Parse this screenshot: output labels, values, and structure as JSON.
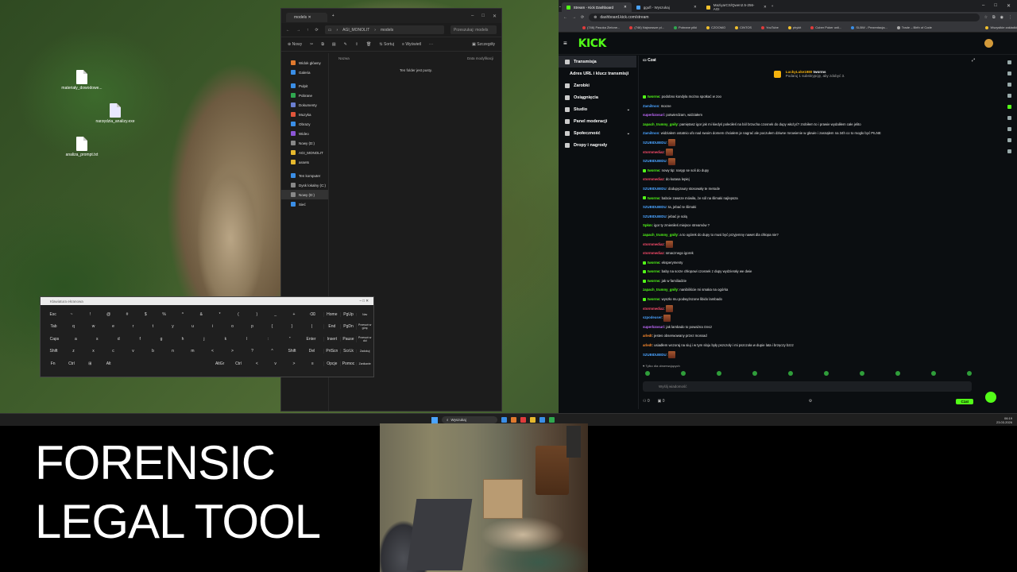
{
  "desktop": {
    "icons": [
      {
        "label": "materiały_dowodowe...",
        "type": "doc"
      },
      {
        "label": "narzędzia_analizy.exe",
        "type": "exe"
      },
      {
        "label": "analiza_prompt.txt",
        "type": "doc"
      }
    ]
  },
  "explorer": {
    "tab_title": "models",
    "path": [
      "AGI_MONOLIT",
      "models"
    ],
    "search_placeholder": "Przeszukaj: models",
    "toolbar": {
      "new": "Nowy",
      "sort": "Sortuj",
      "view": "Wyświetl",
      "details": "Szczegóły"
    },
    "sidebar": [
      {
        "label": "Widok główny",
        "color": "#e07a2e",
        "selected": false
      },
      {
        "label": "Galeria",
        "color": "#3a8ee6",
        "selected": false
      },
      {
        "label": "Pulpit",
        "color": "#3a8ee6",
        "selected": false
      },
      {
        "label": "Pobrane",
        "color": "#2fa84f",
        "selected": false
      },
      {
        "label": "Dokumenty",
        "color": "#6b7fd1",
        "selected": false
      },
      {
        "label": "Muzyka",
        "color": "#e0563b",
        "selected": false
      },
      {
        "label": "Obrazy",
        "color": "#3a8ee6",
        "selected": false
      },
      {
        "label": "Wideo",
        "color": "#8b55d6",
        "selected": false
      },
      {
        "label": "Nowy (D:)",
        "color": "#888888",
        "selected": false
      },
      {
        "label": "AGI_MONOLIT",
        "color": "#e6b82e",
        "selected": false
      },
      {
        "label": "assets",
        "color": "#e6b82e",
        "selected": false
      },
      {
        "label": "Ten komputer",
        "color": "#3a8ee6",
        "selected": false
      },
      {
        "label": "Dysk lokalny (C:)",
        "color": "#888888",
        "selected": false
      },
      {
        "label": "Nowy (D:)",
        "color": "#888888",
        "selected": true
      },
      {
        "label": "Sieć",
        "color": "#3a8ee6",
        "selected": false
      }
    ],
    "columns": {
      "name": "Nazwa",
      "date": "Data modyfikacji"
    },
    "empty_text": "Ten folder jest pusty."
  },
  "keyboard": {
    "title": "Klawiatura ekranowa",
    "rows": [
      [
        "Esc",
        "~",
        "!",
        "@",
        "#",
        "$",
        "%",
        "^",
        "&",
        "*",
        "(",
        ")",
        "_",
        "+",
        "⌫"
      ],
      [
        "Tab",
        "q",
        "w",
        "e",
        "r",
        "t",
        "y",
        "u",
        "i",
        "o",
        "p",
        "{",
        "}",
        "|"
      ],
      [
        "Caps",
        "a",
        "s",
        "d",
        "f",
        "g",
        "h",
        "j",
        "k",
        "l",
        ":",
        "\"",
        "Enter"
      ],
      [
        "Shift",
        "z",
        "x",
        "c",
        "v",
        "b",
        "n",
        "m",
        "<",
        ">",
        "?",
        "^",
        "Shift",
        "Del"
      ],
      [
        "Fn",
        "Ctrl",
        "⊞",
        "Alt",
        "",
        "AltGr",
        "Ctrl",
        "<",
        "v",
        ">",
        "≡"
      ]
    ],
    "side": [
      [
        "Home",
        "PgUp",
        "Nav"
      ],
      [
        "End",
        "PgDn",
        "Przesuń w górę"
      ],
      [
        "Insert",
        "Pause",
        "Przesuń w dół"
      ],
      [
        "PrtScn",
        "ScrLk",
        "Zadokuj"
      ],
      [
        "Opcje",
        "Pomoc",
        "Zanikanie"
      ]
    ]
  },
  "browser": {
    "tabs": [
      {
        "title": "Stream - Kick Dashboard",
        "active": true
      },
      {
        "title": "ggufl - Wyszukaj",
        "active": false
      },
      {
        "title": "MaziyarCS/Qwen2.5-256-AGI",
        "active": false
      }
    ],
    "url": "dashboard.kick.com/stream",
    "bookmarks": [
      {
        "label": "(746) Pasoka Zielone...",
        "color": "#e03b3b"
      },
      {
        "label": "(746) Najnowsze pl...",
        "color": "#e03b3b"
      },
      {
        "label": "Pobrane pliki",
        "color": "#2fa84f"
      },
      {
        "label": "CZOOMO",
        "color": "#f2c12e"
      },
      {
        "label": "CINTOS",
        "color": "#f2c12e"
      },
      {
        "label": "YouTube",
        "color": "#e03b3b"
      },
      {
        "label": "phykit",
        "color": "#f2c12e"
      },
      {
        "label": "Cuber Poker onli...",
        "color": "#e03b3b"
      },
      {
        "label": "SLBW - Prezentacja...",
        "color": "#3a8ee6"
      },
      {
        "label": "Trade – Birth of Code",
        "color": "#aaaaaa"
      },
      {
        "label": "Wszystkie zakładki",
        "color": "#f2c12e"
      }
    ],
    "logo": "KICK"
  },
  "kick": {
    "nav": [
      {
        "label": "Transmisja",
        "selected": true,
        "chevron": false
      },
      {
        "label": "Adres URL i klucz transmisji",
        "selected": false,
        "chevron": false
      },
      {
        "label": "Zarobki",
        "selected": false,
        "chevron": false
      },
      {
        "label": "Osiągnięcia",
        "selected": false,
        "chevron": false
      },
      {
        "label": "Studio",
        "selected": false,
        "chevron": true
      },
      {
        "label": "Panel moderacji",
        "selected": false,
        "chevron": false
      },
      {
        "label": "Społeczność",
        "selected": false,
        "chevron": true
      },
      {
        "label": "Dropy i nagrody",
        "selected": false,
        "chevron": false
      }
    ],
    "chat": {
      "title": "Czat",
      "pinned_user": "LuckyLuke1980",
      "pinned_user2": "tworms",
      "pinned_text": "Podaruj 1 subskrypcję, aby zdobyć 3.",
      "messages": [
        {
          "user": "tworms",
          "color": "#53fc18",
          "text": "podobno kondyla można spotkać w zoo",
          "badge": true,
          "emote": false
        },
        {
          "user": "ZamilInon",
          "color": "#4aa3ff",
          "text": "mocne",
          "badge": false,
          "emote": false
        },
        {
          "user": "superbzosuri",
          "color": "#c46bff",
          "text": "potwierdzam, widziałem",
          "badge": false,
          "emote": false
        },
        {
          "user": "zapach_trumny_gniły",
          "color": "#53fc18",
          "text": "pamiętasz igor jak mi kiedyś poleciłeś na ból brzucha czosnek do dupy włożyć? zrobiłem to i prawie wydaliłem całe jelito",
          "badge": false,
          "emote": false
        },
        {
          "user": "ZamilInon",
          "color": "#4aa3ff",
          "text": "widziałem ostatnio ufo nad swoim domem chciałem je nagrać ale poczułem dziwne mrowienie w głowie i zasnąłem na 34h co to mogło być PILNE",
          "badge": false,
          "emote": false
        },
        {
          "user": "SZUBIDUBIDU",
          "color": "#4aa3ff",
          "text": "",
          "badge": false,
          "emote": true
        },
        {
          "user": "stormmediaz",
          "color": "#ff4d6d",
          "text": "",
          "badge": false,
          "emote": true
        },
        {
          "user": "SZUBIDUBIDU",
          "color": "#4aa3ff",
          "text": "",
          "badge": false,
          "emote": true
        },
        {
          "user": "tworms",
          "color": "#53fc18",
          "text": "nowy tip: nasyp se soli do dupy",
          "badge": true,
          "emote": false
        },
        {
          "user": "stormmediaz",
          "color": "#ff4d6d",
          "text": "do kutasa lepiej",
          "badge": false,
          "emote": false
        },
        {
          "user": "SZUBIDUBIDU",
          "color": "#4aa3ff",
          "text": "dodupyzaury stosowały te metode",
          "badge": false,
          "emote": false
        },
        {
          "user": "tworms",
          "color": "#53fc18",
          "text": "babcie zawsze mówiła, że sól na ślimaki najlepsza",
          "badge": true,
          "emote": false
        },
        {
          "user": "SZUBIDUBIDU",
          "color": "#4aa3ff",
          "text": "ta, jebać te ślimaki",
          "badge": false,
          "emote": false
        },
        {
          "user": "SZUBIDUBIDU",
          "color": "#4aa3ff",
          "text": "jebać je solą",
          "badge": false,
          "emote": false
        },
        {
          "user": "Spkm",
          "color": "#53fc18",
          "text": "igor ty zmieniłeś miejsce streamów ?",
          "badge": false,
          "emote": false
        },
        {
          "user": "zapach_trumny_gniły",
          "color": "#53fc18",
          "text": "a to ogórek do dupy to musi być przyjemny nawet dla chłopa nie?",
          "badge": false,
          "emote": false
        },
        {
          "user": "stormmediaz",
          "color": "#ff4d6d",
          "text": "",
          "badge": false,
          "emote": true
        },
        {
          "user": "stormmediaz",
          "color": "#ff4d6d",
          "text": "smacznego igorek",
          "badge": false,
          "emote": false
        },
        {
          "user": "tworms",
          "color": "#53fc18",
          "text": "eksperymenty",
          "badge": true,
          "emote": false
        },
        {
          "user": "tworms",
          "color": "#53fc18",
          "text": "baby na sorze chłopowi czosnek z dupy wydzierały we dwie",
          "badge": true,
          "emote": false
        },
        {
          "user": "tworms",
          "color": "#53fc18",
          "text": "jak w familiadzie",
          "badge": true,
          "emote": false
        },
        {
          "user": "zapach_trumny_gniły",
          "color": "#53fc18",
          "text": "nanibiliście mi smaka na ogórka",
          "badge": false,
          "emote": false
        },
        {
          "user": "tworms",
          "color": "#53fc18",
          "text": "wyszło mu podwyższone libido lambado",
          "badge": true,
          "emote": false
        },
        {
          "user": "stormmediaz",
          "color": "#ff4d6d",
          "text": "",
          "badge": false,
          "emote": true
        },
        {
          "user": "szpodeuser",
          "color": "#4aa3ff",
          "text": "",
          "badge": false,
          "emote": true
        },
        {
          "user": "superbzosuri",
          "color": "#c46bff",
          "text": "jak lambado to poważna rzecz",
          "badge": false,
          "emote": false
        },
        {
          "user": "arledt",
          "color": "#ff8c2e",
          "text": "jestes obserwowany przez mossad",
          "badge": false,
          "emote": false
        },
        {
          "user": "arledt",
          "color": "#ff8c2e",
          "text": "usiadłem wczoraj na siuj i w tym sloju były pszczoły i mi pszczoła w dupie lata i brzęczy bzzz",
          "badge": false,
          "emote": false
        },
        {
          "user": "SZUBIDUBIDU",
          "color": "#4aa3ff",
          "text": "",
          "badge": false,
          "emote": true
        }
      ],
      "followers_only": "Tylko dla obserwujących",
      "input_placeholder": "Wyślij wiadomość",
      "viewer_count": "0",
      "points": "0",
      "send_label": "Czat"
    }
  },
  "taskbar": {
    "search_placeholder": "Wyszukaj",
    "time": "06:19",
    "date": "23.03.2026",
    "app_colors": [
      "#3a8ee6",
      "#e07a2e",
      "#e03b3b",
      "#e6b82e",
      "#3a8ee6",
      "#2fa84f"
    ]
  },
  "overlay": {
    "line1": "FORENSIC",
    "line2": "LEGAL TOOL"
  }
}
